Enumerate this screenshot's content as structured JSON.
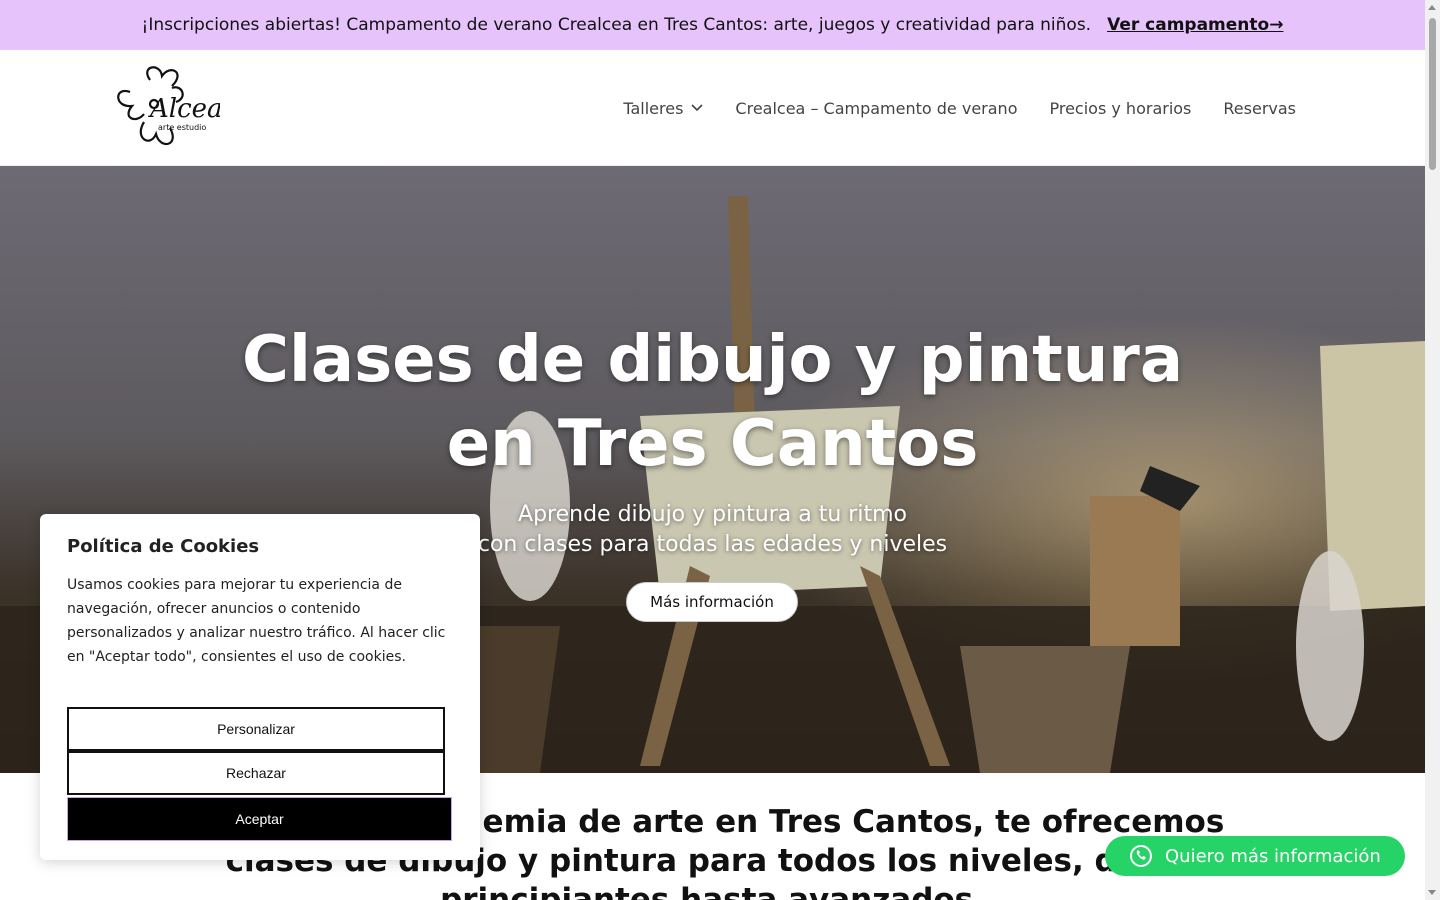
{
  "announcement": {
    "text": "¡Inscripciones abiertas! Campamento de verano Crealcea en Tres Cantos: arte, juegos y creatividad para niños.",
    "cta": "Ver campamento→"
  },
  "header": {
    "logo": {
      "text": "Alcea",
      "subtext": "arte estudio"
    },
    "nav": [
      {
        "label": "Talleres",
        "has_dropdown": true,
        "icon": "chevron-down-icon"
      },
      {
        "label": "Crealcea – Campamento de verano"
      },
      {
        "label": "Precios y horarios"
      },
      {
        "label": "Reservas"
      }
    ]
  },
  "hero": {
    "title_line1": "Clases de dibujo y pintura",
    "title_line2": "en Tres Cantos",
    "subtitle_line1": "Aprende dibujo y pintura a tu ritmo",
    "subtitle_line2": "con clases para todas las edades y niveles",
    "button": "Más información"
  },
  "intro": {
    "text": "En nuestra academia de arte en Tres Cantos, te ofrecemos clases de dibujo y pintura para todos los niveles, desde principiantes hasta avanzados."
  },
  "cookie_banner": {
    "title": "Política de Cookies",
    "body": "Usamos cookies para mejorar tu experiencia de navegación, ofrecer anuncios o contenido personalizados y analizar nuestro tráfico. Al hacer clic en \"Aceptar todo\", consientes el uso de cookies.",
    "customize": "Personalizar",
    "reject": "Rechazar",
    "accept": "Aceptar"
  },
  "whatsapp": {
    "label": "Quiero más información",
    "icon": "whatsapp-icon",
    "color": "#25d366"
  },
  "colors": {
    "announcement_bg": "#e6c3fb",
    "accept_bg": "#000000"
  }
}
